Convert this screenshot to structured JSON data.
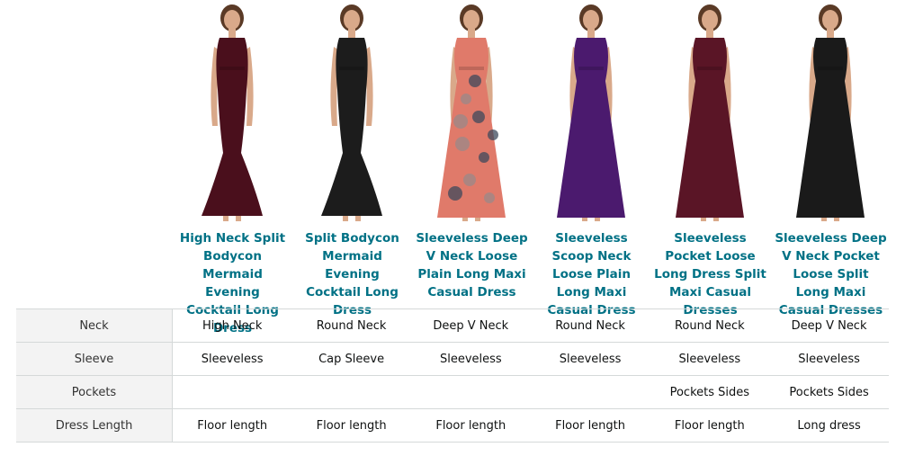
{
  "products": [
    {
      "title": "High Neck Split Bodycon Mermaid Evening Cocktail Long Dress",
      "color": "#4a0f1c",
      "style": "mermaid",
      "image_icon": "burgundy-dress-image"
    },
    {
      "title": "Split Bodycon Mermaid Evening Cocktail Long Dress",
      "color": "#1c1c1c",
      "style": "mermaid",
      "image_icon": "black-dress-image"
    },
    {
      "title": "Sleeveless Deep V Neck Loose Plain Long Maxi Casual Dress",
      "color": "#e07a6a",
      "style": "maxi",
      "image_icon": "floral-dress-image"
    },
    {
      "title": "Sleeveless Scoop Neck Loose Plain Long Maxi Casual Dress",
      "color": "#4b1a6e",
      "style": "maxi",
      "image_icon": "purple-dress-image"
    },
    {
      "title": "Sleeveless Pocket Loose Long Dress Split Maxi Casual Dresses",
      "color": "#5a1526",
      "style": "maxi",
      "image_icon": "wine-dress-image"
    },
    {
      "title": "Sleeveless Deep V Neck Pocket Loose Split Long Maxi Casual Dresses",
      "color": "#1a1a1a",
      "style": "maxi",
      "image_icon": "black-maxi-dress-image"
    }
  ],
  "rows": [
    {
      "label": "Neck",
      "values": [
        "High Neck",
        "Round Neck",
        "Deep V Neck",
        "Round Neck",
        "Round Neck",
        "Deep V Neck"
      ]
    },
    {
      "label": "Sleeve",
      "values": [
        "Sleeveless",
        "Cap Sleeve",
        "Sleeveless",
        "Sleeveless",
        "Sleeveless",
        "Sleeveless"
      ]
    },
    {
      "label": "Pockets",
      "values": [
        "",
        "",
        "",
        "",
        "Pockets Sides",
        "Pockets Sides"
      ]
    },
    {
      "label": "Dress Length",
      "values": [
        "Floor length",
        "Floor length",
        "Floor length",
        "Floor length",
        "Floor length",
        "Long dress"
      ]
    }
  ]
}
